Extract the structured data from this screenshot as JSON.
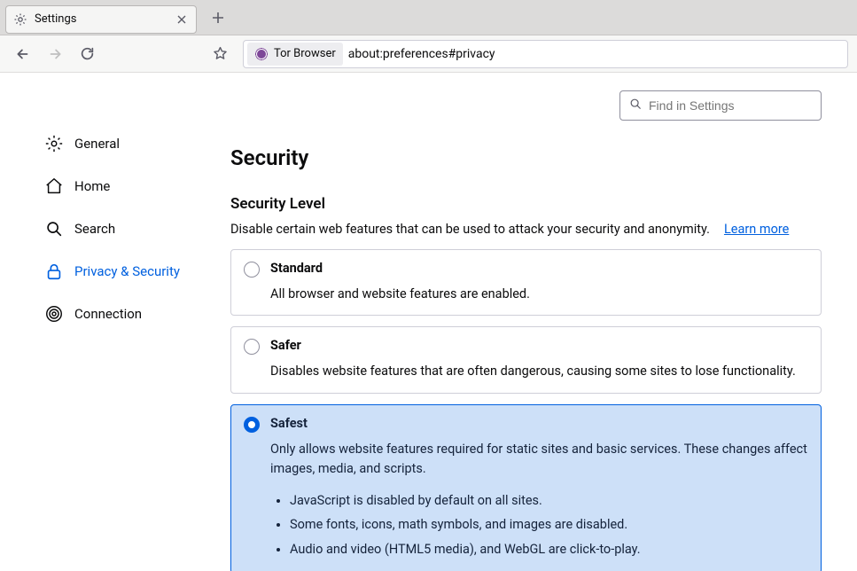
{
  "window": {
    "tab_label": "Settings"
  },
  "toolbar": {
    "identity_label": "Tor Browser",
    "url": "about:preferences#privacy"
  },
  "search": {
    "placeholder": "Find in Settings"
  },
  "sidebar": {
    "items": [
      {
        "label": "General"
      },
      {
        "label": "Home"
      },
      {
        "label": "Search"
      },
      {
        "label": "Privacy & Security"
      },
      {
        "label": "Connection"
      }
    ]
  },
  "main": {
    "page_title": "Security",
    "section_title": "Security Level",
    "section_desc": "Disable certain web features that can be used to attack your security and anonymity.",
    "learn_more": "Learn more",
    "levels": {
      "standard": {
        "title": "Standard",
        "desc": "All browser and website features are enabled."
      },
      "safer": {
        "title": "Safer",
        "desc": "Disables website features that are often dangerous, causing some sites to lose functionality."
      },
      "safest": {
        "title": "Safest",
        "desc": "Only allows website features required for static sites and basic services. These changes affect images, media, and scripts.",
        "bullets": [
          "JavaScript is disabled by default on all sites.",
          "Some fonts, icons, math symbols, and images are disabled.",
          "Audio and video (HTML5 media), and WebGL are click-to-play."
        ]
      }
    }
  }
}
